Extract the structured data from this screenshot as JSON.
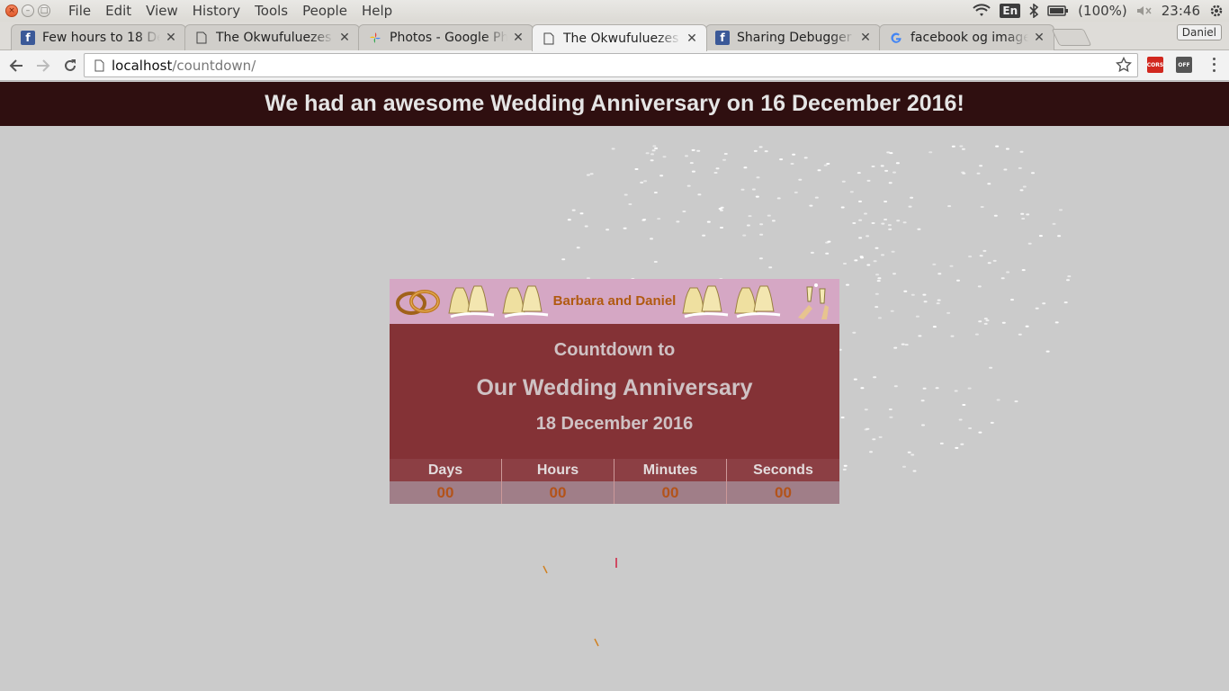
{
  "menubar": {
    "items": [
      "File",
      "Edit",
      "View",
      "History",
      "Tools",
      "People",
      "Help"
    ],
    "battery": "(100%)",
    "clock": "23:46",
    "keyboard": "En"
  },
  "tabs": [
    {
      "title": "Few hours to 18 De",
      "icon": "facebook-icon"
    },
    {
      "title": "The Okwufuluezes",
      "icon": "page-icon"
    },
    {
      "title": "Photos - Google Ph",
      "icon": "google-photos-icon"
    },
    {
      "title": "The Okwufuluezes",
      "icon": "page-icon",
      "active": true
    },
    {
      "title": "Sharing Debugger -",
      "icon": "facebook-icon"
    },
    {
      "title": "facebook og image",
      "icon": "google-icon"
    }
  ],
  "profile": "Daniel",
  "omnibox": {
    "host": "localhost",
    "path": "/countdown/"
  },
  "extensions": {
    "cors": "CORS",
    "off": "OFF"
  },
  "page": {
    "banner": "We had an awesome Wedding Anniversary on 16 December 2016!",
    "names": "Barbara and Daniel",
    "countdown_to": "Countdown to",
    "event": "Our Wedding Anniversary",
    "date": "18 December 2016",
    "units": [
      {
        "label": "Days",
        "value": "00"
      },
      {
        "label": "Hours",
        "value": "00"
      },
      {
        "label": "Minutes",
        "value": "00"
      },
      {
        "label": "Seconds",
        "value": "00"
      }
    ]
  },
  "colors": {
    "banner_bg": "#2f0f10",
    "card_header_bg": "#d5a7c4",
    "card_body_bg": "#843236",
    "accent_orange": "#b05a10",
    "page_bg": "#cbcbcb"
  }
}
